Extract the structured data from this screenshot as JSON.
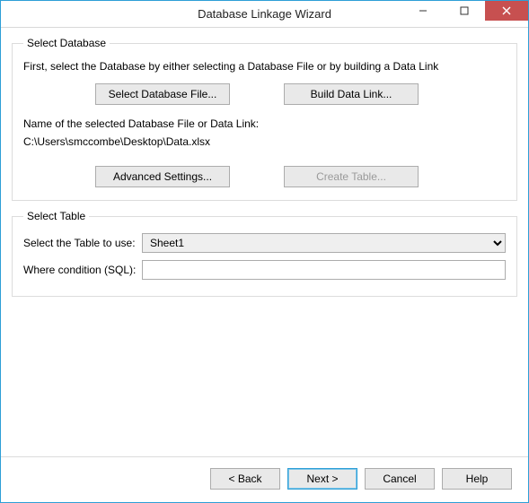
{
  "window": {
    "title": "Database Linkage Wizard"
  },
  "groups": {
    "select_database": {
      "legend": "Select Database",
      "instruction": "First, select the Database by either selecting a Database File or by building a Data Link",
      "select_file_btn": "Select Database File...",
      "build_link_btn": "Build Data Link...",
      "name_label": "Name of the selected Database File or Data Link:",
      "path_value": "C:\\Users\\smccombe\\Desktop\\Data.xlsx",
      "advanced_btn": "Advanced Settings...",
      "create_table_btn": "Create Table..."
    },
    "select_table": {
      "legend": "Select Table",
      "table_label": "Select the Table to use:",
      "table_value": "Sheet1",
      "where_label": "Where condition (SQL):",
      "where_value": ""
    }
  },
  "footer": {
    "back": "< Back",
    "next": "Next >",
    "cancel": "Cancel",
    "help": "Help"
  }
}
